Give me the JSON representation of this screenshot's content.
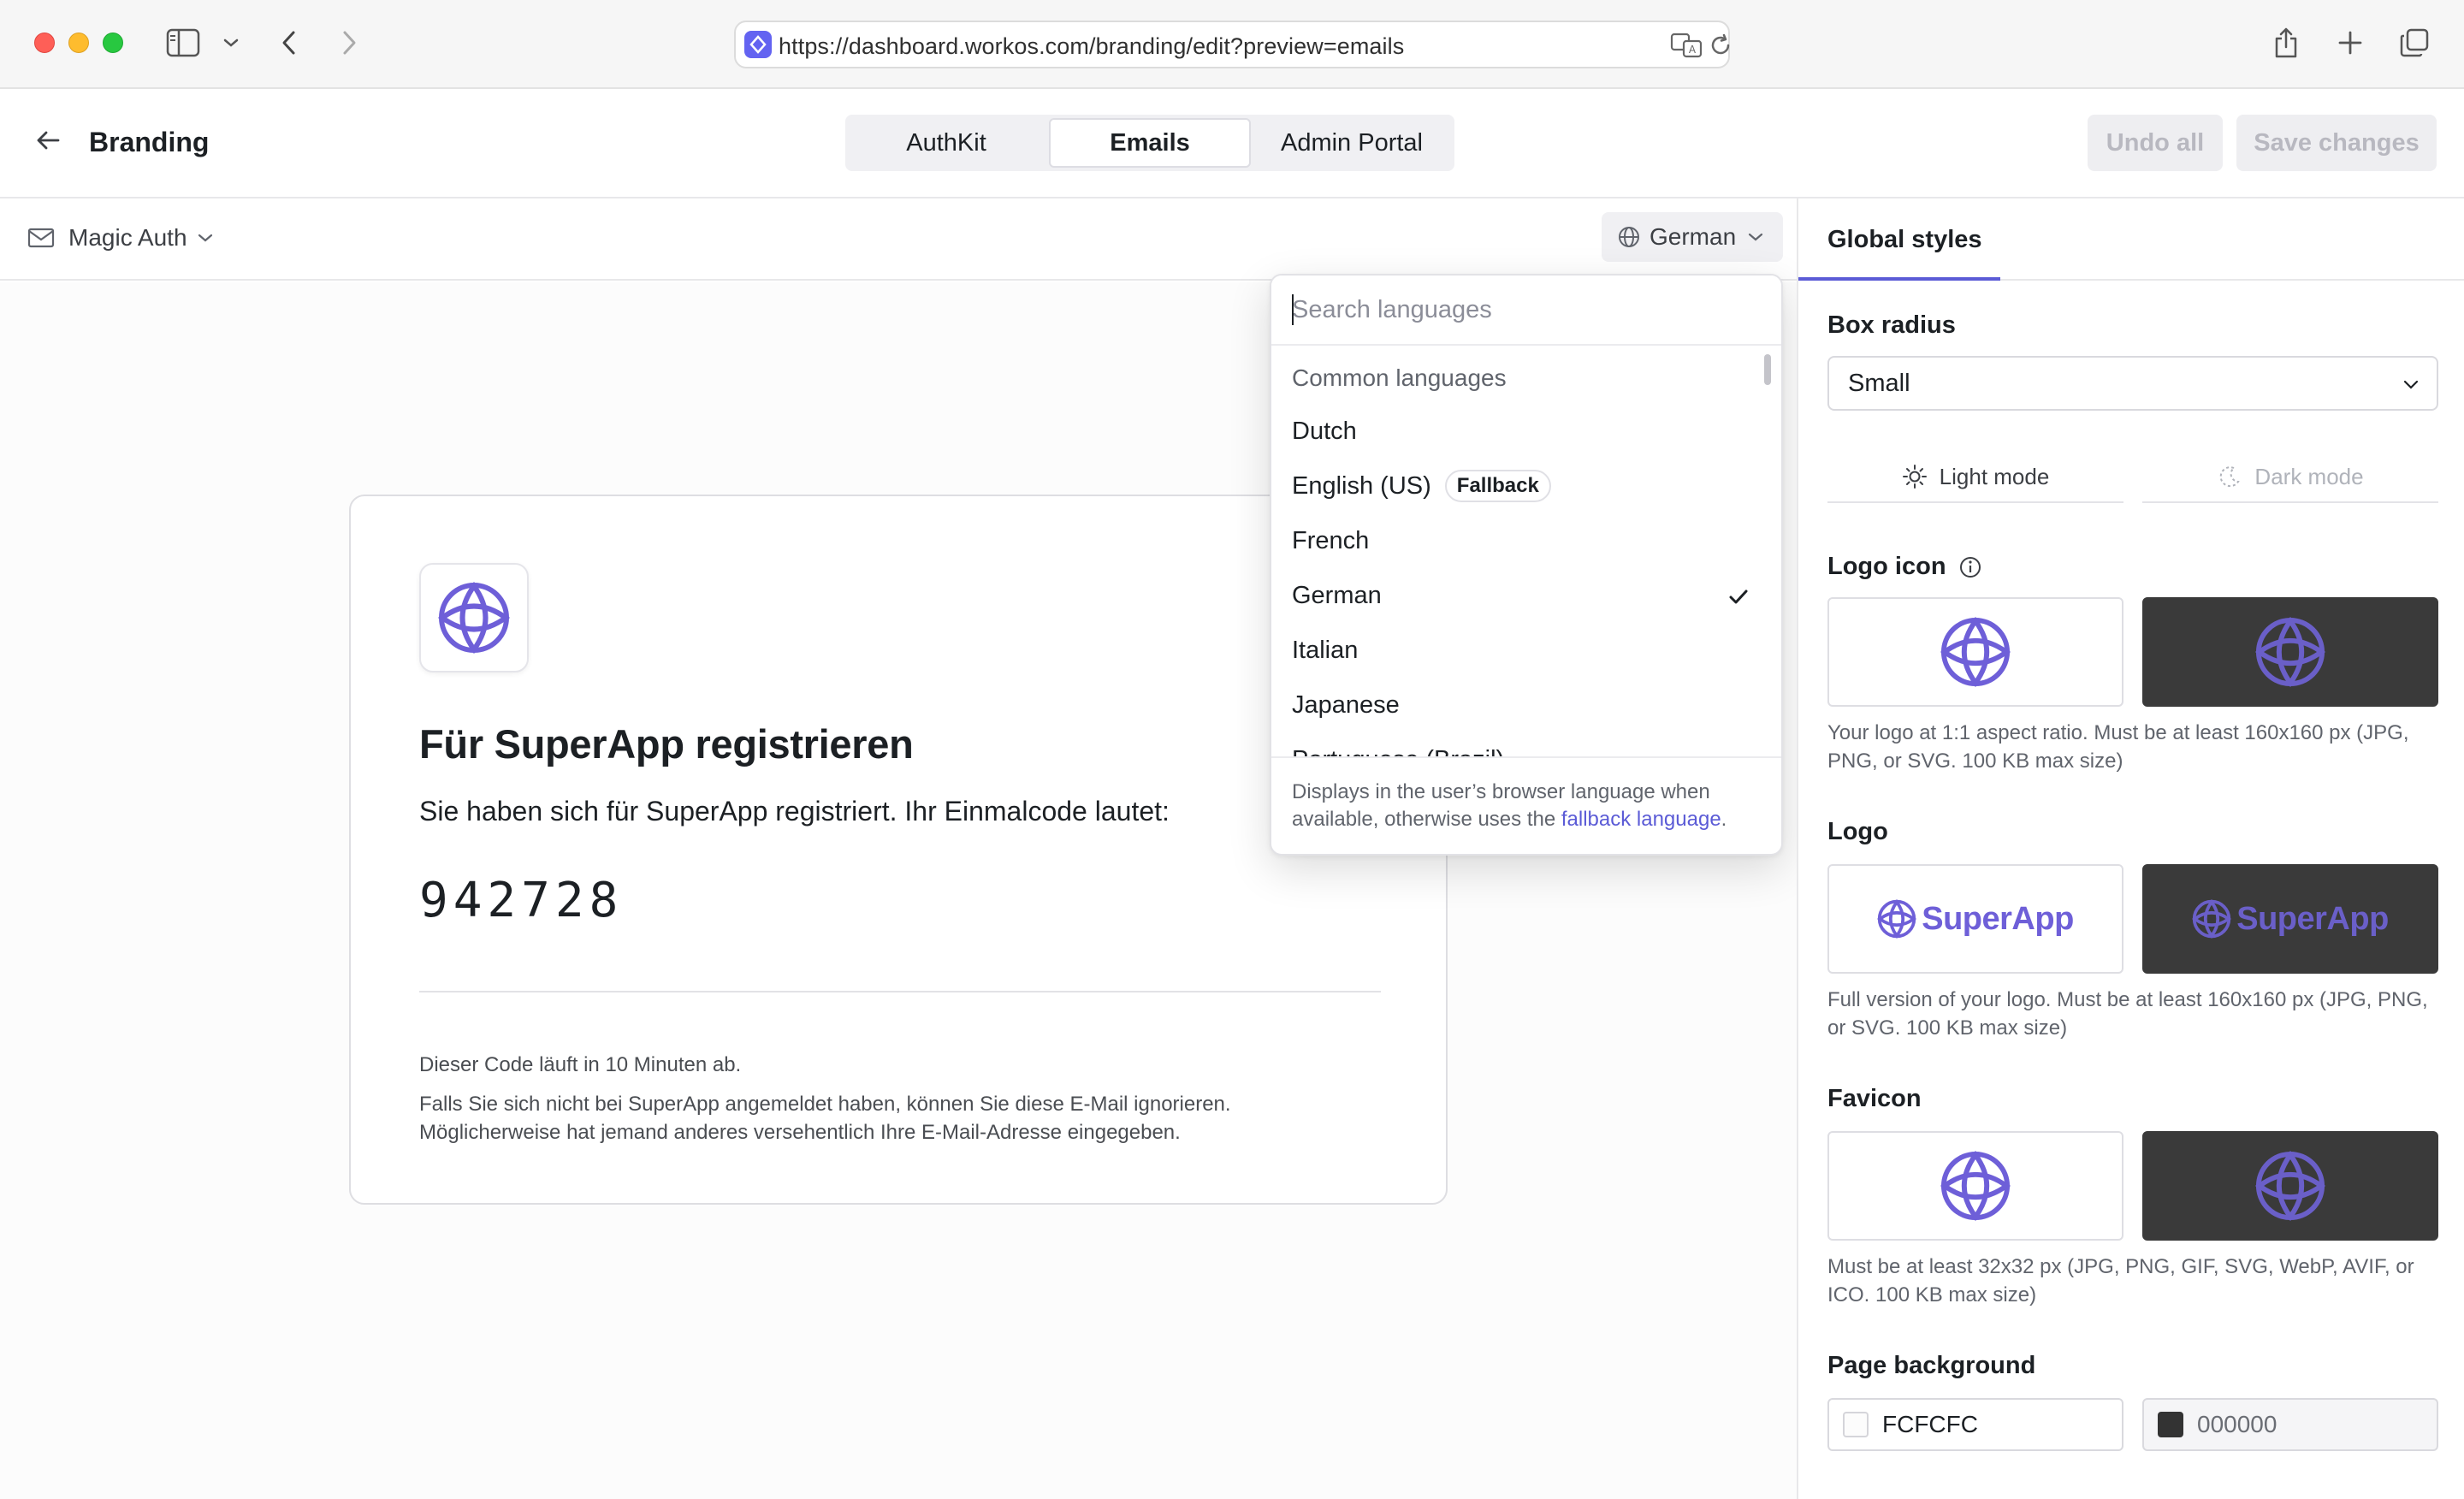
{
  "browser": {
    "url": "https://dashboard.workos.com/branding/edit?preview=emails"
  },
  "header": {
    "title": "Branding",
    "tabs": [
      {
        "label": "AuthKit"
      },
      {
        "label": "Emails"
      },
      {
        "label": "Admin Portal"
      }
    ],
    "active_tab": "Emails",
    "undo_label": "Undo all",
    "save_label": "Save changes"
  },
  "toolbar": {
    "template": "Magic Auth",
    "language": "German"
  },
  "email": {
    "heading": "Für SuperApp registrieren",
    "intro": "Sie haben sich für SuperApp registriert. Ihr Einmalcode lautet:",
    "code": "942728",
    "expiry": "Dieser Code läuft in 10 Minuten ab.",
    "ignore_line1": "Falls Sie sich nicht bei SuperApp angemeldet haben, können Sie diese E-Mail ignorieren.",
    "ignore_line2": "Möglicherweise hat jemand anderes versehentlich Ihre E-Mail-Adresse eingegeben."
  },
  "language_dropdown": {
    "search_placeholder": "Search languages",
    "group_label": "Common languages",
    "items": [
      {
        "label": "Dutch"
      },
      {
        "label": "English (US)",
        "badge": "Fallback"
      },
      {
        "label": "French"
      },
      {
        "label": "German",
        "selected": true
      },
      {
        "label": "Italian"
      },
      {
        "label": "Japanese"
      },
      {
        "label": "Portuguese (Brazil)"
      }
    ],
    "footer_text": "Displays in the user’s browser language when available, otherwise uses the",
    "footer_link": "fallback language",
    "footer_end": "."
  },
  "settings": {
    "tab": "Global styles",
    "box_radius_label": "Box radius",
    "box_radius_value": "Small",
    "light_mode": "Light mode",
    "dark_mode": "Dark mode",
    "logo_icon_label": "Logo icon",
    "logo_icon_help": "Your logo at 1:1 aspect ratio. Must be at least 160x160 px (JPG, PNG, or SVG. 100 KB max size)",
    "logo_label": "Logo",
    "logo_wordmark": "SuperApp",
    "logo_help": "Full version of your logo. Must be at least 160x160 px (JPG, PNG, or SVG. 100 KB max size)",
    "favicon_label": "Favicon",
    "favicon_help": "Must be at least 32x32 px (JPG, PNG, GIF, SVG, WebP, AVIF, or ICO. 100 KB max size)",
    "page_bg_label": "Page background",
    "page_bg_light": "FCFCFC",
    "page_bg_dark": "000000"
  },
  "colors": {
    "accent": "#5b5bd6",
    "logo_purple": "#6e5fd8",
    "dark_tile": "#3a3a3a"
  }
}
